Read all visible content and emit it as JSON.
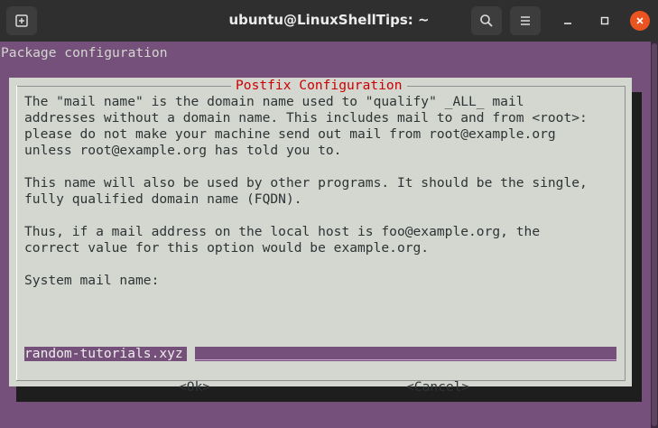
{
  "window": {
    "title": "ubuntu@LinuxShellTips: ~",
    "new_tab_icon": "new-tab-icon",
    "search_icon": "search-icon",
    "menu_icon": "hamburger-menu-icon",
    "minimize_icon": "minimize-icon",
    "maximize_icon": "maximize-icon",
    "close_icon": "close-icon",
    "close_color": "#e95420",
    "terminal_bg": "#75507b"
  },
  "terminal": {
    "header": "Package configuration"
  },
  "dialog": {
    "title": "Postfix Configuration",
    "title_color": "#cc0000",
    "body": "The \"mail name\" is the domain name used to \"qualify\" _ALL_ mail\naddresses without a domain name. This includes mail to and from <root>:\nplease do not make your machine send out mail from root@example.org\nunless root@example.org has told you to.\n\nThis name will also be used by other programs. It should be the single,\nfully qualified domain name (FQDN).\n\nThus, if a mail address on the local host is foo@example.org, the\ncorrect value for this option would be example.org.\n\nSystem mail name:",
    "input_value": "random-tutorials.xyz",
    "ok_label": "<Ok>",
    "cancel_label": "<Cancel>"
  }
}
